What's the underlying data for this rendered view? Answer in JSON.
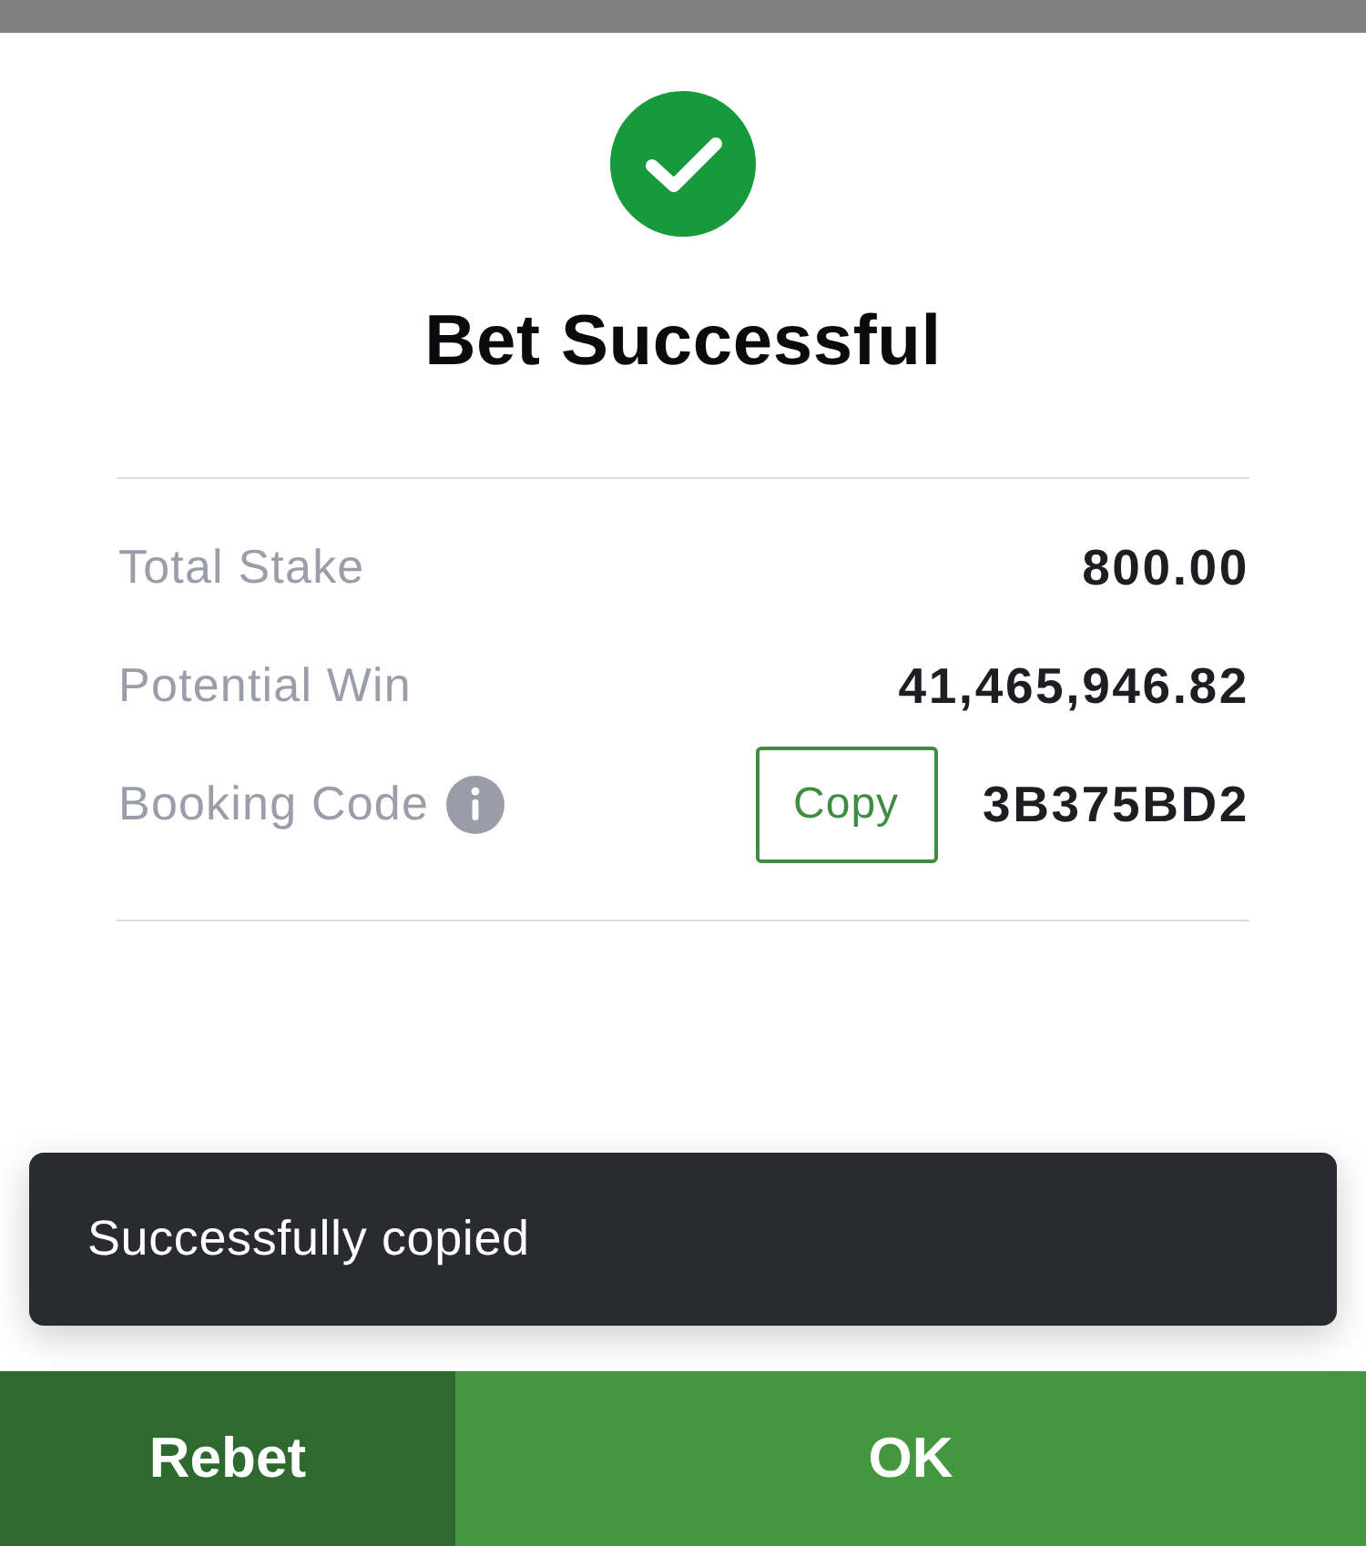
{
  "header": {
    "title": "Bet Successful"
  },
  "summary": {
    "rows": [
      {
        "kind": "amount",
        "label": "Total Stake",
        "value": "800.00"
      },
      {
        "kind": "amount",
        "label": "Potential Win",
        "value": "41,465,946.82"
      },
      {
        "kind": "code",
        "label": "Booking Code",
        "value": "3B375BD2",
        "button": "Copy"
      }
    ]
  },
  "toast": {
    "message": "Successfully copied"
  },
  "actions": [
    {
      "kind": "secondary",
      "label": "Rebet"
    },
    {
      "kind": "primary",
      "label": "OK"
    }
  ]
}
